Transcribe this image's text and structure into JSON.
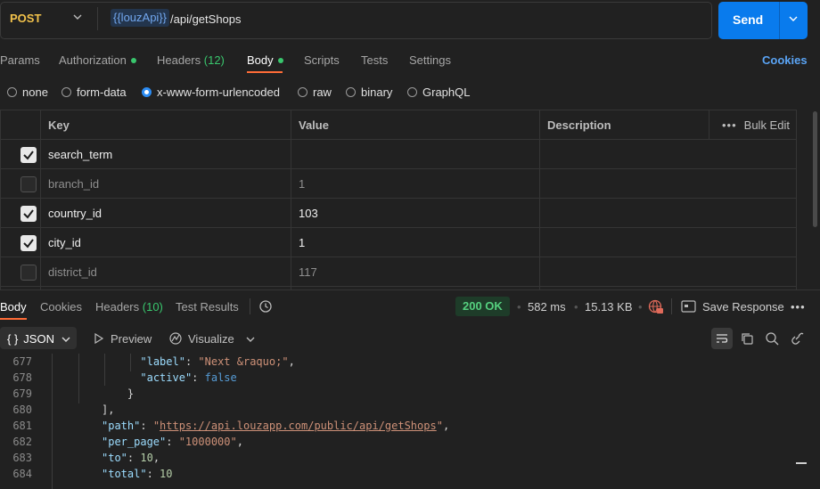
{
  "request": {
    "method": "POST",
    "url_variable": "{{louzApi}}",
    "url_path": " /api/getShops",
    "send_label": "Send"
  },
  "request_tabs": [
    {
      "label": "Params"
    },
    {
      "label": "Authorization"
    },
    {
      "label": "Headers",
      "count": "(12)"
    },
    {
      "label": "Body"
    },
    {
      "label": "Scripts"
    },
    {
      "label": "Tests"
    },
    {
      "label": "Settings"
    }
  ],
  "cookies_label": "Cookies",
  "body_types": [
    "none",
    "form-data",
    "x-www-form-urlencoded",
    "raw",
    "binary",
    "GraphQL"
  ],
  "selected_body_type": "x-www-form-urlencoded",
  "params_table": {
    "headers": {
      "key": "Key",
      "value": "Value",
      "description": "Description",
      "bulk_edit": "Bulk Edit"
    },
    "rows": [
      {
        "key": "search_term",
        "value": "",
        "description": "",
        "checked": true
      },
      {
        "key": "branch_id",
        "value": "1",
        "description": "",
        "checked": false
      },
      {
        "key": "country_id",
        "value": "103",
        "description": "",
        "checked": true
      },
      {
        "key": "city_id",
        "value": "1",
        "description": "",
        "checked": true
      },
      {
        "key": "district_id",
        "value": "117",
        "description": "",
        "checked": false
      }
    ]
  },
  "response": {
    "tabs": [
      {
        "label": "Body"
      },
      {
        "label": "Cookies"
      },
      {
        "label": "Headers",
        "count": "(10)"
      },
      {
        "label": "Test Results"
      }
    ],
    "status": "200 OK",
    "time": "582 ms",
    "size": "15.13 KB",
    "save_label": "Save Response",
    "format": "JSON",
    "preview_label": "Preview",
    "visualize_label": "Visualize"
  },
  "code_lines": [
    {
      "n": "677",
      "indent": 10,
      "parts": [
        [
          "k",
          "\"label\""
        ],
        [
          "p",
          ": "
        ],
        [
          "s",
          "\"Next &raquo;\""
        ],
        [
          "p",
          ","
        ]
      ]
    },
    {
      "n": "678",
      "indent": 10,
      "parts": [
        [
          "k",
          "\"active\""
        ],
        [
          "p",
          ": "
        ],
        [
          "b",
          "false"
        ]
      ]
    },
    {
      "n": "679",
      "indent": 8,
      "parts": [
        [
          "p",
          "}"
        ]
      ]
    },
    {
      "n": "680",
      "indent": 4,
      "parts": [
        [
          "p",
          "],"
        ]
      ]
    },
    {
      "n": "681",
      "indent": 4,
      "parts": [
        [
          "k",
          "\"path\""
        ],
        [
          "p",
          ": "
        ],
        [
          "s",
          "\""
        ],
        [
          "u",
          "https://api.louzapp.com/public/api/getShops"
        ],
        [
          "s",
          "\""
        ],
        [
          "p",
          ","
        ]
      ]
    },
    {
      "n": "682",
      "indent": 4,
      "parts": [
        [
          "k",
          "\"per_page\""
        ],
        [
          "p",
          ": "
        ],
        [
          "s",
          "\"1000000\""
        ],
        [
          "p",
          ","
        ]
      ]
    },
    {
      "n": "683",
      "indent": 4,
      "parts": [
        [
          "k",
          "\"to\""
        ],
        [
          "p",
          ": "
        ],
        [
          "n",
          "10"
        ],
        [
          "p",
          ","
        ]
      ]
    },
    {
      "n": "684",
      "indent": 4,
      "parts": [
        [
          "k",
          "\"total\""
        ],
        [
          "p",
          ": "
        ],
        [
          "n",
          "10"
        ]
      ]
    }
  ],
  "colors": {
    "accent": "#ff6c37",
    "send": "#097bed",
    "ok": "#55d07f",
    "method": "#f2c24b"
  }
}
